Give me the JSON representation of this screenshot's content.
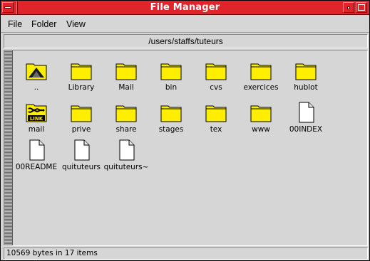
{
  "window": {
    "title": "File Manager"
  },
  "menubar": {
    "file": "File",
    "folder": "Folder",
    "view": "View"
  },
  "path": "/users/staffs/tuteurs",
  "items": [
    {
      "label": "..",
      "type": "parent"
    },
    {
      "label": "Library",
      "type": "folder"
    },
    {
      "label": "Mail",
      "type": "folder"
    },
    {
      "label": "bin",
      "type": "folder"
    },
    {
      "label": "cvs",
      "type": "folder"
    },
    {
      "label": "exercices",
      "type": "folder"
    },
    {
      "label": "hublot",
      "type": "folder"
    },
    {
      "label": "mail",
      "type": "link"
    },
    {
      "label": "prive",
      "type": "folder"
    },
    {
      "label": "share",
      "type": "folder"
    },
    {
      "label": "stages",
      "type": "folder"
    },
    {
      "label": "tex",
      "type": "folder"
    },
    {
      "label": "www",
      "type": "folder"
    },
    {
      "label": "00INDEX",
      "type": "file"
    },
    {
      "label": "00README",
      "type": "file"
    },
    {
      "label": "quituteurs",
      "type": "file"
    },
    {
      "label": "quituteurs~",
      "type": "file"
    }
  ],
  "link_badge": "LINK",
  "status": "10569 bytes in 17 items",
  "colors": {
    "titlebar": "#e0242b",
    "folder": "#ffee00",
    "background": "#d6d6d6"
  }
}
